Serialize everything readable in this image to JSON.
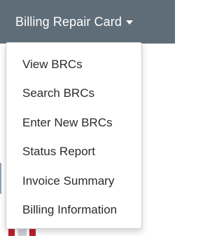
{
  "nav": {
    "trigger_label": "Billing Repair Card"
  },
  "menu": {
    "items": [
      {
        "label": "View BRCs"
      },
      {
        "label": "Search BRCs"
      },
      {
        "label": "Enter New BRCs"
      },
      {
        "label": "Status Report"
      },
      {
        "label": "Invoice Summary"
      },
      {
        "label": "Billing Information"
      }
    ]
  },
  "colors": {
    "topbar": "#5f6d78",
    "menu_text": "#2b2b2b",
    "accent_red": "#c0202a"
  }
}
